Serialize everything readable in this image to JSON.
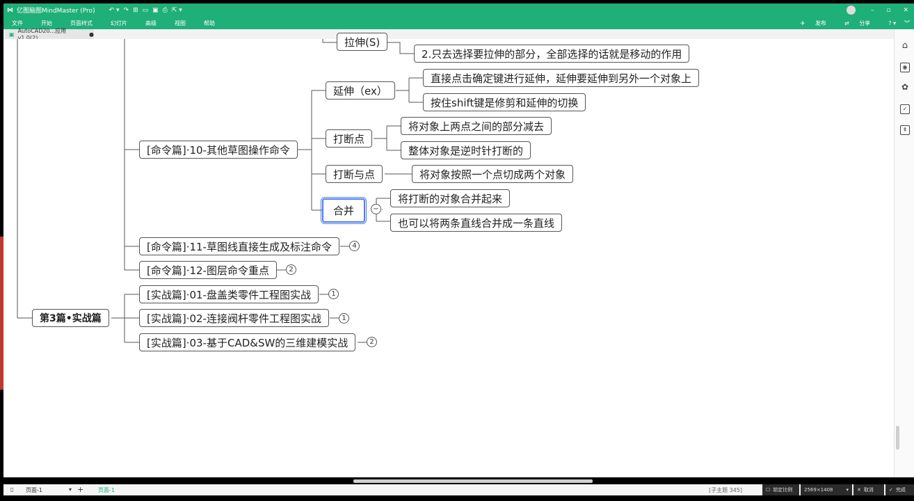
{
  "app": {
    "title": "亿图脑图MindMaster (Pro)",
    "menu": [
      "文件",
      "开始",
      "页面样式",
      "幻灯片",
      "高级",
      "视图",
      "帮助"
    ],
    "doc_tab": "AutoCAD20...应用v1.0(2)",
    "publish": "发布",
    "share": "分享"
  },
  "map": {
    "stretch": "拉伸(S)",
    "stretch_2": "2.只去选择要拉伸的部分，全部选择的话就是移动的作用",
    "extend": "延伸（ex）",
    "extend_1": "直接点击确定键进行延伸，延伸要延伸到另外一个对象上",
    "extend_2": "按住shift键是修剪和延伸的切换",
    "cmd10": "[命令篇]·10-其他草图操作命令",
    "break": "打断点",
    "break_1": "将对象上两点之间的部分减去",
    "break_2": "整体对象是逆时针打断的",
    "break_at": "打断与点",
    "break_at_1": "将对象按照一个点切成两个对象",
    "join": "合并",
    "join_1": "将打断的对象合并起来",
    "join_2": "也可以将两条直线合并成一条直线",
    "cmd11": "[命令篇]·11-草图线直接生成及标注命令",
    "cmd11_badge": "4",
    "cmd12": "[命令篇]·12-图层命令重点",
    "cmd12_badge": "2",
    "part3": "第3篇•实战篇",
    "p01": "[实战篇]·01-盘盖类零件工程图实战",
    "p01_badge": "1",
    "p02": "[实战篇]·02-连接阀杆零件工程图实战",
    "p02_badge": "1",
    "p03": "[实战篇]·03-基于CAD&SW的三维建模实战",
    "p03_badge": "2"
  },
  "status": {
    "page_select": "页面-1",
    "page_tab": "页面-1",
    "count": "[子主题 345]",
    "lock_ratio": "锁定比例",
    "size": "2569×1408",
    "cancel": "取消",
    "confirm": "完成"
  },
  "colors": {
    "brand": "#1faf78",
    "selection": "#4c7ee8"
  }
}
